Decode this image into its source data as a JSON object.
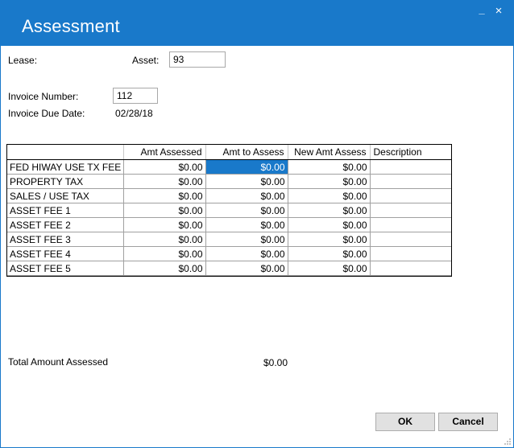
{
  "window": {
    "title": "Assessment",
    "minimize_glyph": "_",
    "close_glyph": "×"
  },
  "form": {
    "lease_label": "Lease:",
    "asset_label": "Asset:",
    "asset_value": "93",
    "invoice_number_label": "Invoice Number:",
    "invoice_number_value": "112",
    "invoice_due_label": "Invoice Due Date:",
    "invoice_due_value": "02/28/18"
  },
  "grid": {
    "headers": [
      "",
      "Amt Assessed",
      "Amt to Assess",
      "New Amt Assess",
      "Description"
    ],
    "rows": [
      {
        "name": "FED HIWAY USE TX FEE",
        "assessed": "$0.00",
        "to_assess": "$0.00",
        "new_assess": "$0.00",
        "description": ""
      },
      {
        "name": "PROPERTY TAX",
        "assessed": "$0.00",
        "to_assess": "$0.00",
        "new_assess": "$0.00",
        "description": ""
      },
      {
        "name": "SALES / USE TAX",
        "assessed": "$0.00",
        "to_assess": "$0.00",
        "new_assess": "$0.00",
        "description": ""
      },
      {
        "name": "ASSET FEE 1",
        "assessed": "$0.00",
        "to_assess": "$0.00",
        "new_assess": "$0.00",
        "description": ""
      },
      {
        "name": "ASSET FEE 2",
        "assessed": "$0.00",
        "to_assess": "$0.00",
        "new_assess": "$0.00",
        "description": ""
      },
      {
        "name": "ASSET FEE 3",
        "assessed": "$0.00",
        "to_assess": "$0.00",
        "new_assess": "$0.00",
        "description": ""
      },
      {
        "name": "ASSET FEE 4",
        "assessed": "$0.00",
        "to_assess": "$0.00",
        "new_assess": "$0.00",
        "description": ""
      },
      {
        "name": "ASSET FEE 5",
        "assessed": "$0.00",
        "to_assess": "$0.00",
        "new_assess": "$0.00",
        "description": ""
      }
    ]
  },
  "totals": {
    "label": "Total Amount Assessed",
    "value": "$0.00"
  },
  "buttons": {
    "ok_label": "OK",
    "cancel_label": "Cancel"
  },
  "colors": {
    "accent": "#1979ca",
    "button_face": "#e1e1e1"
  }
}
